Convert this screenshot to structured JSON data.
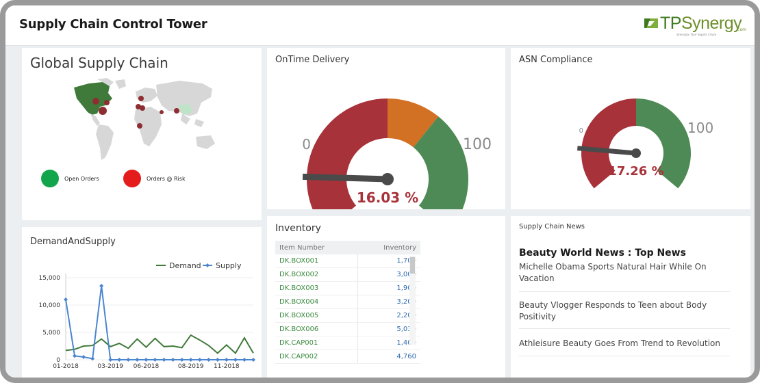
{
  "app": {
    "title": "Supply Chain Control Tower",
    "logo_text_tp": "TP",
    "logo_text_synergy": "Synergy",
    "logo_com": ".com",
    "logo_tagline": "Synergize Your Supply Chain"
  },
  "global_supply_chain": {
    "title": "Global Supply Chain",
    "legend": [
      {
        "label": "Open Orders",
        "color": "#12a54b"
      },
      {
        "label": "Orders @ Risk",
        "color": "#e51c1c"
      }
    ]
  },
  "ontime_delivery": {
    "title": "OnTime Delivery",
    "value": 16.03,
    "value_text": "16.03 %",
    "min_label": "0",
    "max_label": "100",
    "bands": [
      {
        "from": 0,
        "to": 50,
        "color": "#a8323a"
      },
      {
        "from": 50,
        "to": 65,
        "color": "#d27024"
      },
      {
        "from": 65,
        "to": 100,
        "color": "#4e8a55"
      }
    ]
  },
  "asn_compliance": {
    "title": "ASN Compliance",
    "value": 17.26,
    "value_text": "17.26 %",
    "min_label": "0",
    "max_label": "100",
    "bands": [
      {
        "from": 0,
        "to": 50,
        "color": "#a8323a"
      },
      {
        "from": 50,
        "to": 100,
        "color": "#4e8a55"
      }
    ]
  },
  "demand_supply": {
    "title": "DemandAndSupply",
    "legend": [
      {
        "label": "Demand",
        "color": "#3f7a3a"
      },
      {
        "label": "Supply",
        "color": "#4a86d0"
      }
    ]
  },
  "inventory": {
    "title": "Inventory",
    "columns": [
      "Item Number",
      "Inventory"
    ],
    "rows": [
      {
        "item": "DK.BOX001",
        "qty": "1,700"
      },
      {
        "item": "DK.BOX002",
        "qty": "3,000"
      },
      {
        "item": "DK.BOX003",
        "qty": "1,900"
      },
      {
        "item": "DK.BOX004",
        "qty": "3,200"
      },
      {
        "item": "DK.BOX005",
        "qty": "2,200"
      },
      {
        "item": "DK.BOX006",
        "qty": "5,030"
      },
      {
        "item": "DK.CAP001",
        "qty": "1,400"
      },
      {
        "item": "DK.CAP002",
        "qty": "4,760"
      }
    ]
  },
  "news": {
    "title": "Supply Chain News",
    "heading": "Beauty World News : Top News",
    "items": [
      "Michelle Obama Sports Natural Hair While On Vacation",
      "Beauty Vlogger Responds to Teen about Body Positivity",
      "Athleisure Beauty Goes From Trend to Revolution"
    ]
  },
  "chart_data": {
    "type": "line",
    "title": "DemandAndSupply",
    "x_tick_labels": [
      "01-2018",
      "03-2019",
      "06-2018",
      "08-2019",
      "11-2018"
    ],
    "x_tick_positions": [
      0,
      5,
      9,
      14,
      18
    ],
    "y_tick_labels": [
      "0",
      "5,000",
      "10,000",
      "15,000"
    ],
    "ylim": [
      0,
      15000
    ],
    "point_count": 22,
    "series": [
      {
        "name": "Demand",
        "color": "#3f7a3a",
        "values": [
          1700,
          1900,
          2500,
          2600,
          3800,
          2400,
          3000,
          2100,
          3800,
          2300,
          3900,
          2400,
          2500,
          2200,
          4500,
          3600,
          2600,
          1200,
          2700,
          1200,
          4000,
          1200,
          1000,
          1600
        ]
      },
      {
        "name": "Supply",
        "color": "#4a86d0",
        "values": [
          11000,
          700,
          500,
          200,
          13500,
          0,
          0,
          0,
          0,
          0,
          0,
          0,
          0,
          0,
          0,
          0,
          0,
          0,
          0,
          0,
          0,
          0,
          0,
          0
        ]
      }
    ]
  }
}
